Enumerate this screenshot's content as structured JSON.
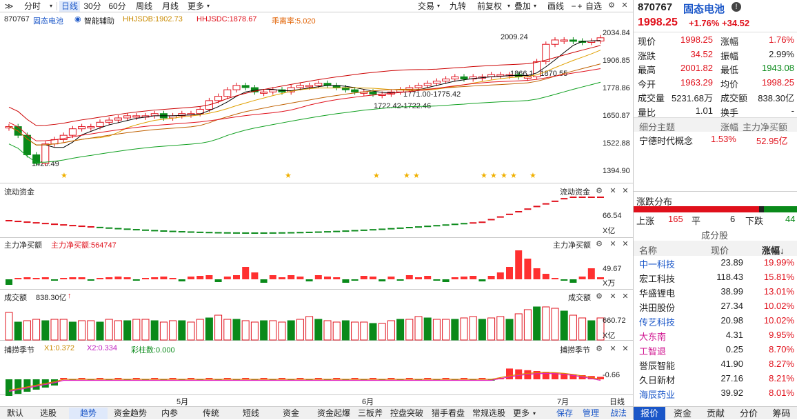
{
  "toolbar": {
    "left": [
      "分时",
      "日线",
      "30分",
      "60分",
      "周线",
      "月线",
      "更多"
    ],
    "right": [
      "交易",
      "九转",
      "前复权",
      "叠加",
      "画线",
      "自选"
    ],
    "icons": [
      "≫",
      "+",
      "⚙",
      "✕"
    ]
  },
  "chart": {
    "code": "870767",
    "name": "固态电池",
    "assist": "智能辅助",
    "hhjsdb": "HHJSDB:1902.73",
    "hhjsdc": "HHJSDC:1878.67",
    "rate": "乖离率:5.020",
    "price_axis": [
      "2034.84",
      "1906.85",
      "1778.86",
      "1650.87",
      "1522.88",
      "1394.90"
    ],
    "annotations": [
      "2009.24",
      "1866.13-1870.55",
      "1771.00-1775.42",
      "1722.42-1722.46",
      "1420.49"
    ]
  },
  "flow": {
    "title": "流动资金",
    "right_title": "流动资金",
    "axis": "66.54",
    "unit": "X亿"
  },
  "net": {
    "title": "主力净买额",
    "value": "主力净买额:564747",
    "right_title": "主力净买额",
    "axis": "49.67",
    "unit": "X万"
  },
  "vol": {
    "title": "成交额",
    "value": "838.30亿",
    "right_title": "成交额",
    "axis": "660.72",
    "unit": "X亿"
  },
  "season": {
    "title": "捕捞季节",
    "x1": "X1:0.372",
    "x2": "X2:0.334",
    "bar": "彩柱数:0.000",
    "right_title": "捕捞季节",
    "axis": "-0.66"
  },
  "dates": [
    "5月",
    "6月",
    "7月"
  ],
  "bottom_tabs": [
    "默认",
    "选股",
    "趋势",
    "资金趋势",
    "内参",
    "传统",
    "短线",
    "资金",
    "资金起爆",
    "三板斧",
    "控盘突破",
    "猎手看盘",
    "常规选股",
    "更多"
  ],
  "bottom_right": [
    "保存",
    "管理",
    "战法"
  ],
  "dayline": "日线",
  "quote": {
    "code": "870767",
    "name": "固态电池",
    "price": "1998.25",
    "change_pct": "+1.76%",
    "change": "+34.52",
    "rows": [
      [
        "现价",
        "1998.25",
        "涨幅",
        "1.76%"
      ],
      [
        "涨跌",
        "34.52",
        "振幅",
        "2.99%"
      ],
      [
        "最高",
        "2001.82",
        "最低",
        "1943.08"
      ],
      [
        "今开",
        "1963.29",
        "均价",
        "1998.25"
      ],
      [
        "成交量",
        "5231.68万",
        "成交额",
        "838.30亿"
      ],
      [
        "量比",
        "1.01",
        "换手",
        "-"
      ]
    ]
  },
  "topic": {
    "h1": "细分主题",
    "h2": "涨幅",
    "h3": "主力净买额",
    "name": "宁德时代概念",
    "pct": "1.53%",
    "amt": "52.95亿"
  },
  "dist": {
    "title": "涨跌分布",
    "up_label": "上涨",
    "up": "165",
    "flat_label": "平",
    "flat": "6",
    "down_label": "下跌",
    "down": "44"
  },
  "comp": {
    "title": "成分股",
    "h1": "名称",
    "h2": "现价",
    "h3": "涨幅↓",
    "rows": [
      {
        "name": "中一科技",
        "price": "23.89",
        "pct": "19.99%",
        "c": "blue"
      },
      {
        "name": "宏工科技",
        "price": "118.43",
        "pct": "15.81%",
        "c": "black"
      },
      {
        "name": "华盛锂电",
        "price": "38.99",
        "pct": "13.01%",
        "c": "black"
      },
      {
        "name": "洪田股份",
        "price": "27.34",
        "pct": "10.02%",
        "c": "black"
      },
      {
        "name": "传艺科技",
        "price": "20.98",
        "pct": "10.02%",
        "c": "blue"
      },
      {
        "name": "大东南",
        "price": "4.31",
        "pct": "9.95%",
        "c": "pink"
      },
      {
        "name": "工智退",
        "price": "0.25",
        "pct": "8.70%",
        "c": "pink"
      },
      {
        "name": "誉辰智能",
        "price": "41.90",
        "pct": "8.27%",
        "c": "black"
      },
      {
        "name": "久日新材",
        "price": "27.16",
        "pct": "8.21%",
        "c": "black"
      },
      {
        "name": "海辰药业",
        "price": "39.92",
        "pct": "8.01%",
        "c": "blue"
      }
    ]
  },
  "right_tabs": [
    "报价",
    "资金",
    "贡献",
    "分价",
    "筹码"
  ]
}
